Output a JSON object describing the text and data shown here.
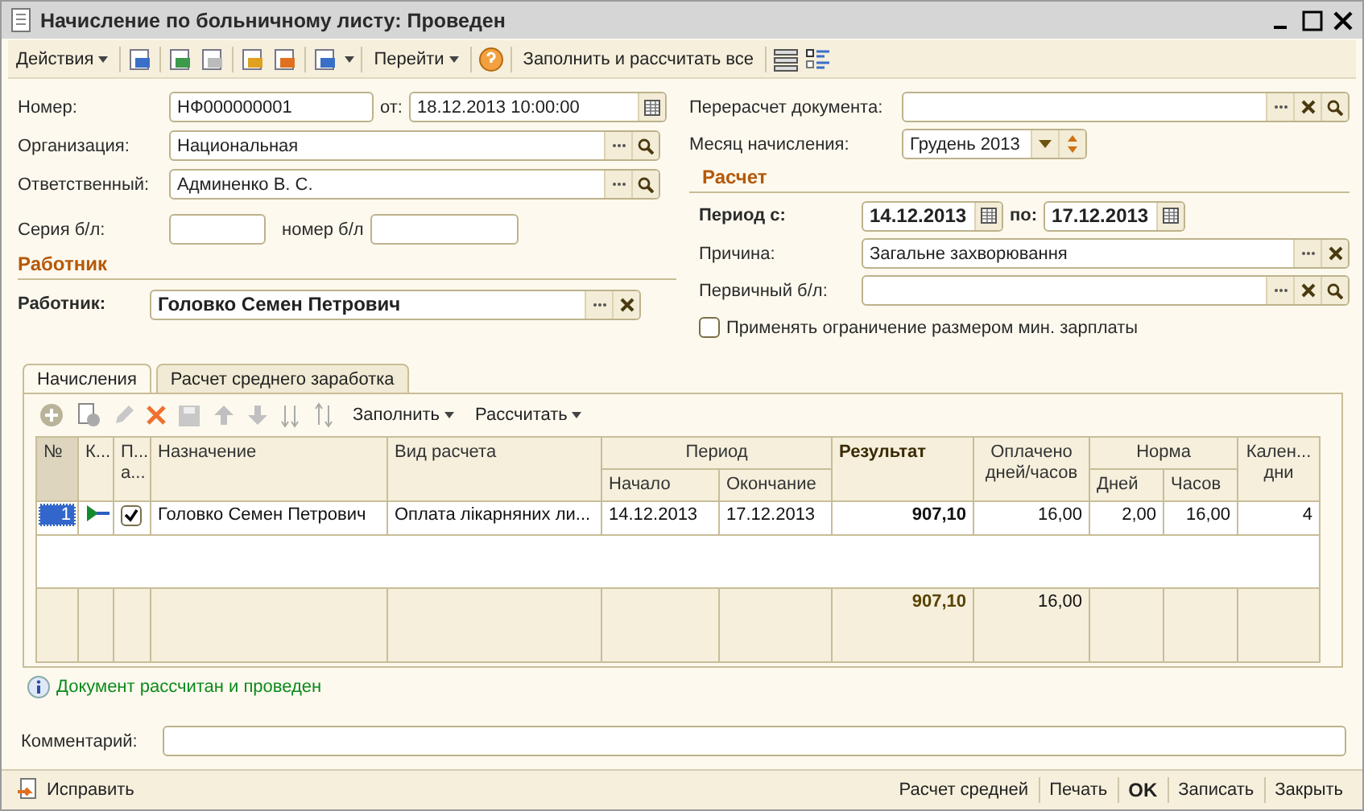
{
  "window": {
    "title": "Начисление по больничному листу: Проведен"
  },
  "toolbar": {
    "actions": "Действия",
    "goto": "Перейти",
    "fill_all": "Заполнить и рассчитать все"
  },
  "header": {
    "number": {
      "label": "Номер:",
      "value": "НФ000000001"
    },
    "date": {
      "label": "от:",
      "value": "18.12.2013 10:00:00"
    },
    "organization": {
      "label": "Организация:",
      "value": "Национальная"
    },
    "responsible": {
      "label": "Ответственный:",
      "value": "Админенко В. С."
    },
    "sick_series": {
      "label": "Серия б/л:"
    },
    "sick_number": {
      "label": "номер б/л"
    },
    "recalc": {
      "label": "Перерасчет документа:"
    },
    "month": {
      "label": "Месяц начисления:",
      "value": "Грудень 2013"
    }
  },
  "employee_section": {
    "title": "Работник",
    "label": "Работник:",
    "value": "Головко Семен Петрович"
  },
  "calc_section": {
    "title": "Расчет",
    "period_label": "Период с:",
    "from": "14.12.2013",
    "to_label": "по:",
    "to": "17.12.2013",
    "reason": {
      "label": "Причина:",
      "value": "Загальне захворювання"
    },
    "primary": {
      "label": "Первичный б/л:"
    },
    "min_wage": {
      "label": "Применять ограничение размером мин. зарплаты",
      "checked": false
    }
  },
  "tabs": [
    {
      "label": "Начисления",
      "selected": true
    },
    {
      "label": "Расчет среднего заработка",
      "selected": false
    }
  ],
  "table_toolbar": {
    "fill": "Заполнить",
    "calculate": "Рассчитать"
  },
  "table": {
    "columns": {
      "number": "№",
      "kind": "К...",
      "included": [
        "П...",
        "а..."
      ],
      "designation": "Назначение",
      "calc_type": "Вид расчета",
      "period": "Период",
      "start": "Начало",
      "end": "Окончание",
      "result": "Результат",
      "paid": [
        "Оплачено",
        "дней/часов"
      ],
      "norm": "Норма",
      "norm_days": "Дней",
      "norm_hours": "Часов",
      "calendar_days": [
        "Кален...",
        "дни"
      ]
    },
    "rows": [
      {
        "number": "1",
        "selected": true,
        "included": true,
        "designation": "Головко Семен Петрович",
        "calc_type": "Оплата лікарняних ли...",
        "start": "14.12.2013",
        "end": "17.12.2013",
        "result": "907,10",
        "paid": "16,00",
        "norm_days": "2,00",
        "norm_hours": "16,00",
        "calendar_days": "4"
      }
    ],
    "totals": {
      "result": "907,10",
      "paid": "16,00"
    }
  },
  "status": "Документ рассчитан и проведен",
  "comment": {
    "label": "Комментарий:"
  },
  "footer": {
    "fix": "Исправить",
    "buttons": [
      {
        "label": "Расчет средней",
        "default": false
      },
      {
        "label": "Печать",
        "default": false
      },
      {
        "label": "OK",
        "default": true
      },
      {
        "label": "Записать",
        "default": false
      },
      {
        "label": "Закрыть",
        "default": false
      }
    ]
  }
}
